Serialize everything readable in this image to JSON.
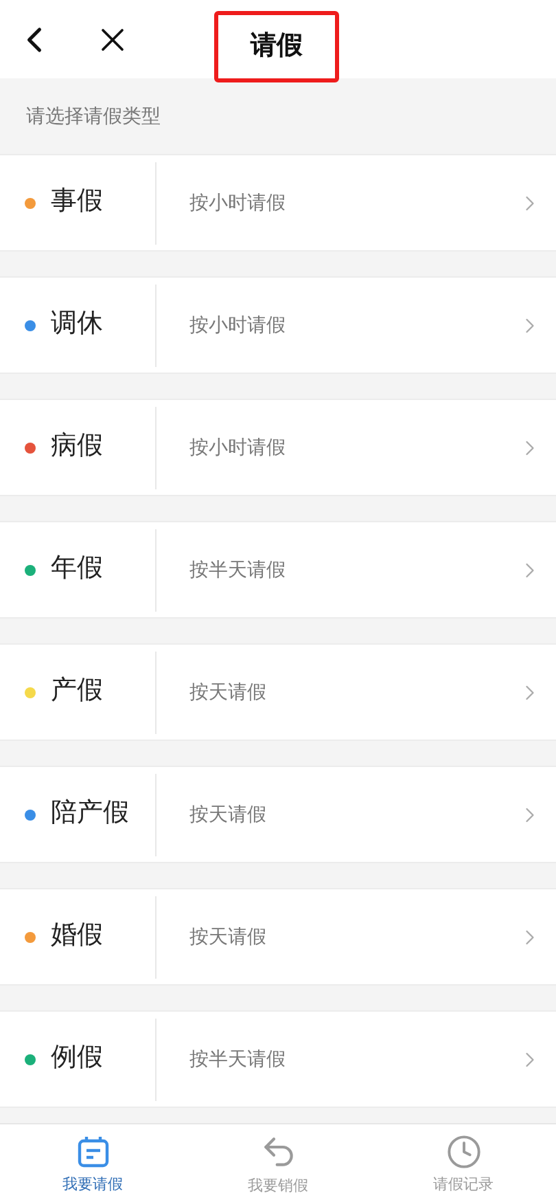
{
  "header": {
    "title": "请假",
    "title_highlighted": true
  },
  "subtitle": "请选择请假类型",
  "leave_types": [
    {
      "name": "事假",
      "rule": "按小时请假",
      "color": "#f39a3c"
    },
    {
      "name": "调休",
      "rule": "按小时请假",
      "color": "#3a8ee6"
    },
    {
      "name": "病假",
      "rule": "按小时请假",
      "color": "#e5533c"
    },
    {
      "name": "年假",
      "rule": "按半天请假",
      "color": "#1bb07a"
    },
    {
      "name": "产假",
      "rule": "按天请假",
      "color": "#f5d94a"
    },
    {
      "name": "陪产假",
      "rule": "按天请假",
      "color": "#3a8ee6"
    },
    {
      "name": "婚假",
      "rule": "按天请假",
      "color": "#f39a3c"
    },
    {
      "name": "例假",
      "rule": "按半天请假",
      "color": "#1bb07a"
    }
  ],
  "tab_bar": [
    {
      "label": "我要请假",
      "kind": "calendar",
      "selected": true
    },
    {
      "label": "我要销假",
      "kind": "undo",
      "selected": false
    },
    {
      "label": "请假记录",
      "kind": "clock",
      "selected": false
    }
  ]
}
